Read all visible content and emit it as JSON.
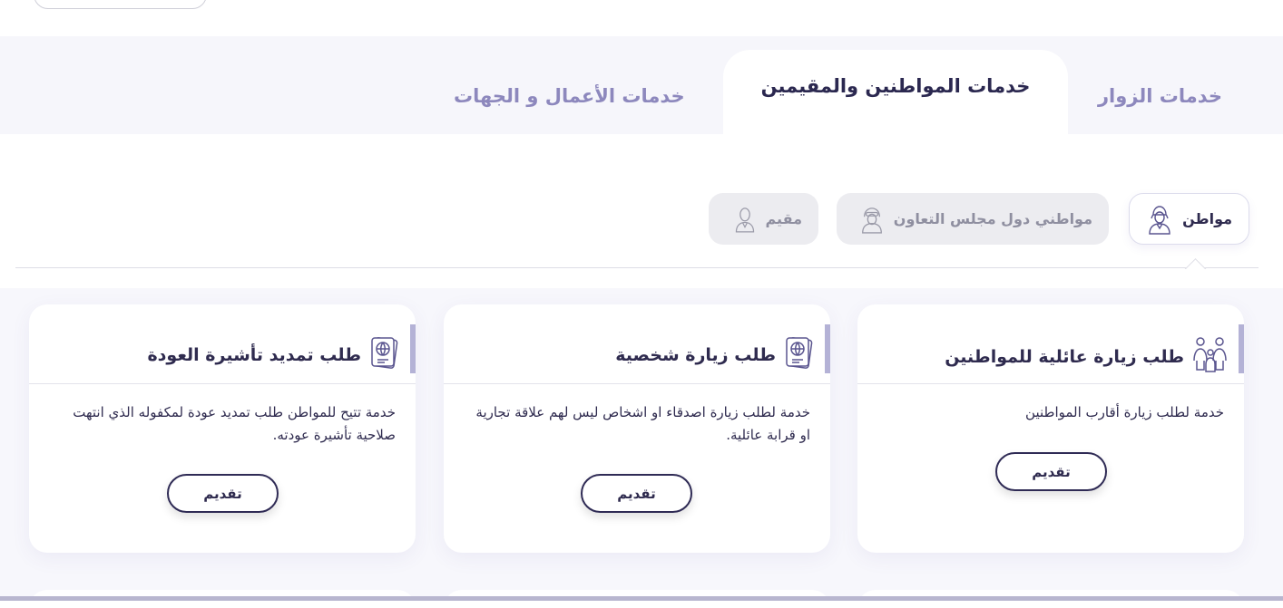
{
  "tabs": {
    "visitors": "خدمات الزوار",
    "citizens": "خدمات المواطنين والمقيمين",
    "business": "خدمات الأعمال و الجهات"
  },
  "user_types": {
    "citizen": "مواطن",
    "gcc": "مواطني دول مجلس التعاون",
    "resident": "مقيم"
  },
  "cards": [
    {
      "title": "طلب زيارة عائلية للمواطنين",
      "description": "خدمة لطلب زيارة أقارب المواطنين",
      "button": "تقديم",
      "icon": "family-icon"
    },
    {
      "title": "طلب زيارة شخصية",
      "description": "خدمة لطلب زيارة اصدقاء او اشخاص ليس لهم علاقة تجارية او قرابة عائلية.",
      "button": "تقديم",
      "icon": "passport-icon"
    },
    {
      "title": "طلب تمديد تأشيرة العودة",
      "description": "خدمة تتيح للمواطن طلب تمديد عودة لمكفوله الذي انتهت صلاحية تأشيرة عودته.",
      "button": "تقديم",
      "icon": "passport-icon"
    }
  ],
  "colors": {
    "accent": "#2f2b55",
    "tab_inactive": "#8d88bd",
    "card_bar": "#b4b2d6"
  }
}
